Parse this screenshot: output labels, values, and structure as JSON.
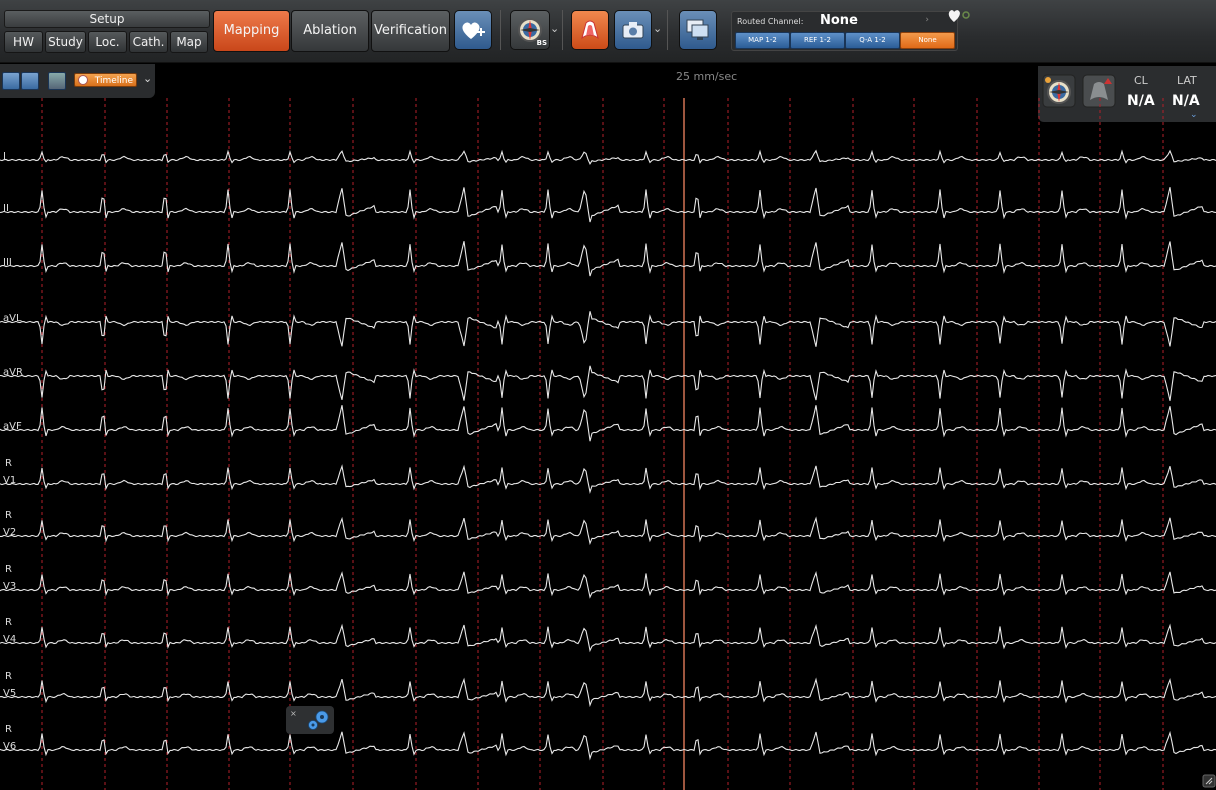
{
  "toolbar": {
    "setup_title": "Setup",
    "setup_tabs": [
      "HW",
      "Study",
      "Loc.",
      "Cath.",
      "Map"
    ],
    "mapping": "Mapping",
    "ablation": "Ablation",
    "verification": "Verification",
    "bs_badge": "BS",
    "routed_channel_label": "Routed Channel:",
    "routed_channel_value": "None",
    "channel_buttons": [
      "MAP 1-2",
      "REF 1-2",
      "Q-A 1-2",
      "None"
    ],
    "channel_selected": "None"
  },
  "timeline": {
    "label": "Timeline"
  },
  "sweep_speed": "25 mm/sec",
  "measurements": {
    "cl_label": "CL",
    "cl_value": "N/A",
    "lat_label": "LAT",
    "lat_value": "N/A"
  },
  "leads": [
    {
      "name": "I",
      "ref": ""
    },
    {
      "name": "II",
      "ref": ""
    },
    {
      "name": "III",
      "ref": ""
    },
    {
      "name": "aVL",
      "ref": ""
    },
    {
      "name": "aVR",
      "ref": ""
    },
    {
      "name": "aVF",
      "ref": ""
    },
    {
      "name": "V1",
      "ref": "R"
    },
    {
      "name": "V2",
      "ref": "R"
    },
    {
      "name": "V3",
      "ref": "R"
    },
    {
      "name": "V4",
      "ref": "R"
    },
    {
      "name": "V5",
      "ref": "R"
    },
    {
      "name": "V6",
      "ref": "R"
    }
  ],
  "colors": {
    "accent": "#d65a26",
    "grid_line": "#b3202a",
    "trace": "#e8e8e8",
    "cursor": "#e07a5a"
  }
}
